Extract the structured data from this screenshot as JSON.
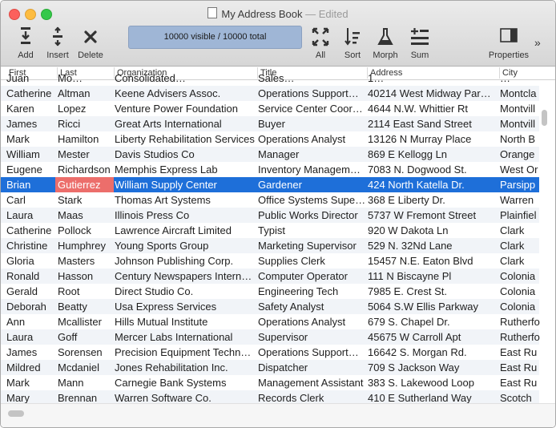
{
  "window": {
    "title": "My Address Book",
    "edited": "— Edited"
  },
  "toolbar": {
    "add_label": "Add",
    "insert_label": "Insert",
    "delete_label": "Delete",
    "status": "10000 visible / 10000 total",
    "all_label": "All",
    "sort_label": "Sort",
    "morph_label": "Morph",
    "sum_label": "Sum",
    "properties_label": "Properties",
    "overflow": "»"
  },
  "table": {
    "columns": [
      "First",
      "Last",
      "Organization",
      "Title",
      "Address",
      "City"
    ],
    "partial_row": [
      "Juan",
      "Mo…",
      "Consolidated…",
      "Sales…",
      "1…",
      "…"
    ],
    "rows": [
      [
        "Catherine",
        "Altman",
        "Keene Advisers Assoc.",
        "Operations Support…",
        "40214 West Midway Par…",
        "Montcla"
      ],
      [
        "Karen",
        "Lopez",
        "Venture Power Foundation",
        "Service Center Coor…",
        "4644 N.W. Whittier Rt",
        "Montvill"
      ],
      [
        "James",
        "Ricci",
        "Great Arts International",
        "Buyer",
        "2114 East Sand Street",
        "Montvill"
      ],
      [
        "Mark",
        "Hamilton",
        "Liberty Rehabilitation Services",
        "Operations Analyst",
        "13126 N Murray Place",
        "North B"
      ],
      [
        "William",
        "Mester",
        "Davis Studios Co",
        "Manager",
        "869 E Kellogg Ln",
        "Orange"
      ],
      [
        "Eugene",
        "Richardson",
        "Memphis Express Lab",
        "Inventory Managem…",
        "7083 N. Dogwood St.",
        "West Or"
      ],
      [
        "Brian",
        "Gutierrez",
        "William Supply Center",
        "Gardener",
        "424 North Katella Dr.",
        "Parsipp"
      ],
      [
        "Carl",
        "Stark",
        "Thomas Art Systems",
        "Office Systems Supe…",
        "368 E Liberty Dr.",
        "Warren"
      ],
      [
        "Laura",
        "Maas",
        "Illinois Press Co",
        "Public Works Director",
        "5737 W Fremont Street",
        "Plainfiel"
      ],
      [
        "Catherine",
        "Pollock",
        "Lawrence Aircraft Limited",
        "Typist",
        "920 W Dakota Ln",
        "Clark"
      ],
      [
        "Christine",
        "Humphrey",
        "Young Sports Group",
        "Marketing Supervisor",
        "529 N. 32Nd Lane",
        "Clark"
      ],
      [
        "Gloria",
        "Masters",
        "Johnson Publishing Corp.",
        "Supplies Clerk",
        "15457 N.E. Eaton Blvd",
        "Clark"
      ],
      [
        "Ronald",
        "Hasson",
        "Century Newspapers Intern…",
        "Computer Operator",
        "111 N Biscayne Pl",
        "Colonia"
      ],
      [
        "Gerald",
        "Root",
        "Direct Studio Co.",
        "Engineering Tech",
        "7985 E. Crest St.",
        "Colonia"
      ],
      [
        "Deborah",
        "Beatty",
        "Usa Express Services",
        "Safety Analyst",
        "5064 S.W Ellis Parkway",
        "Colonia"
      ],
      [
        "Ann",
        "Mcallister",
        "Hills Mutual Institute",
        "Operations Analyst",
        "679 S. Chapel Dr.",
        "Rutherfo"
      ],
      [
        "Laura",
        "Goff",
        "Mercer Labs International",
        "Supervisor",
        "45675 W Carroll Apt",
        "Rutherfo"
      ],
      [
        "James",
        "Sorensen",
        "Precision Equipment Techn…",
        "Operations Support…",
        "16642 S. Morgan Rd.",
        "East Ru"
      ],
      [
        "Mildred",
        "Mcdaniel",
        "Jones Rehabilitation Inc.",
        "Dispatcher",
        "709 S Jackson Way",
        "East Ru"
      ],
      [
        "Mark",
        "Mann",
        "Carnegie Bank Systems",
        "Management Assistant",
        "383 S. Lakewood Loop",
        "East Ru"
      ],
      [
        "Mary",
        "Brennan",
        "Warren Software Co.",
        "Records Clerk",
        "410 E Sutherland Way",
        "Scotch"
      ]
    ],
    "selected_row_index": 6,
    "highlight_cell": "Gutierrez"
  },
  "colors": {
    "selection": "#1e6fd9",
    "cell_highlight": "#ec6e6b",
    "status_box": "#9fb6d6"
  },
  "icons": [
    "add-icon",
    "insert-icon",
    "delete-icon",
    "all-icon",
    "sort-icon",
    "morph-icon",
    "sum-icon",
    "properties-icon"
  ]
}
